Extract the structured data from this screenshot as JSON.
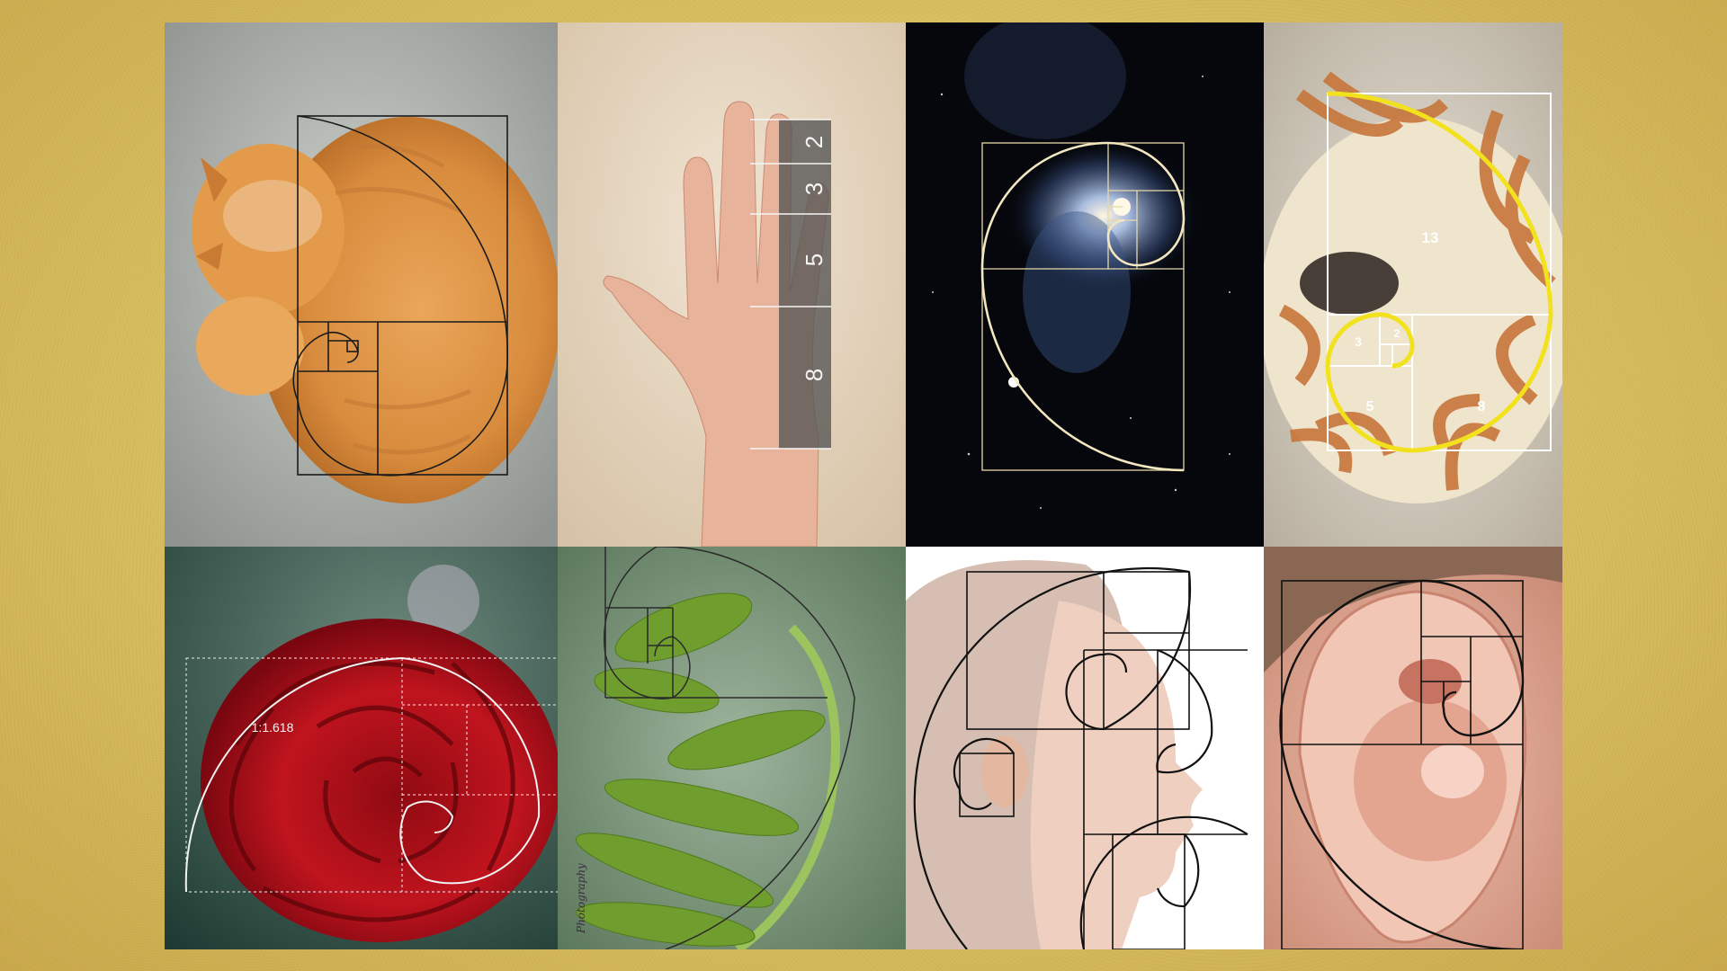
{
  "panels": [
    {
      "subject": "sleeping orange cat"
    },
    {
      "subject": "hand with finger bone ratios",
      "labels": [
        "2",
        "3",
        "5",
        "8"
      ]
    },
    {
      "subject": "spiral galaxy"
    },
    {
      "subject": "nautilus shell",
      "labels": [
        "13",
        "2",
        "3",
        "5",
        "8"
      ]
    },
    {
      "subject": "red rose",
      "ratio_label": "1:1.618"
    },
    {
      "subject": "unfurling fern frond",
      "watermark": "Photography"
    },
    {
      "subject": "woman's face in profile"
    },
    {
      "subject": "human ear"
    }
  ],
  "colors": {
    "background_gold": "#d8bd5e",
    "spiral_black": "#111111",
    "spiral_white": "#f2f2f2",
    "spiral_yellow": "#f2e21e",
    "galaxy_gold": "#e8d9a8"
  }
}
